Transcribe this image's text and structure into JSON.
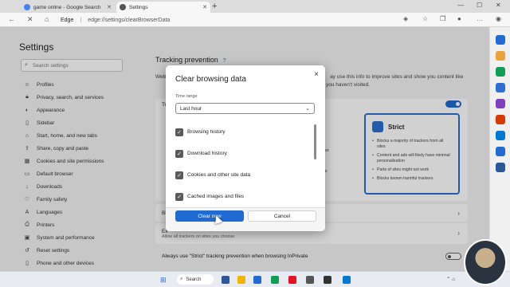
{
  "tabs": [
    {
      "title": "game online - Google Search",
      "favicon_color": "#4285f4"
    },
    {
      "title": "Settings",
      "favicon_color": "#555555"
    }
  ],
  "tab_new": "+",
  "window": {
    "min": "—",
    "max": "☐",
    "close": "✕"
  },
  "address": {
    "brand": "Edge",
    "separator": "|",
    "url": "edge://settings/clearBrowserData"
  },
  "sidebar": {
    "title": "Settings",
    "search_placeholder": "Search settings",
    "items": [
      {
        "label": "Profiles",
        "icon": "person-icon"
      },
      {
        "label": "Privacy, search, and services",
        "icon": "lock-icon"
      },
      {
        "label": "Appearance",
        "icon": "palette-icon"
      },
      {
        "label": "Sidebar",
        "icon": "sidebar-icon"
      },
      {
        "label": "Start, home, and new tabs",
        "icon": "home-icon"
      },
      {
        "label": "Share, copy and paste",
        "icon": "share-icon"
      },
      {
        "label": "Cookies and site permissions",
        "icon": "cookie-icon"
      },
      {
        "label": "Default browser",
        "icon": "browser-icon"
      },
      {
        "label": "Downloads",
        "icon": "download-icon"
      },
      {
        "label": "Family safety",
        "icon": "family-icon"
      },
      {
        "label": "Languages",
        "icon": "language-icon"
      },
      {
        "label": "Printers",
        "icon": "printer-icon"
      },
      {
        "label": "System and performance",
        "icon": "system-icon"
      },
      {
        "label": "Reset settings",
        "icon": "reset-icon"
      },
      {
        "label": "Phone and other devices",
        "icon": "phone-icon"
      }
    ]
  },
  "content": {
    "section_title": "Tracking prevention",
    "help": "?",
    "description_prefix": "Web",
    "description": "ay use this info to improve sites and show you content like",
    "description_line2": "you haven't visited.",
    "panel_label_left": "Tr",
    "peek_lines": [
      "you",
      "y be less",
      "ted",
      "trackers"
    ],
    "strict": {
      "title": "Strict",
      "bullets": [
        "Blocks a majority of trackers from all sites",
        "Content and ads will likely have minimal personalization",
        "Parts of sites might not work",
        "Blocks known harmful trackers"
      ]
    },
    "row1_label": "Bl",
    "row2_label": "Ex",
    "row2_sub": "Allow all trackers on sites you choose",
    "inprivate": "Always use \"Strict\" tracking prevention when browsing InPrivate"
  },
  "dialog": {
    "title": "Clear browsing data",
    "close": "×",
    "time_range_label": "Time range",
    "time_range_value": "Last hour",
    "options": [
      {
        "label": "Browsing history",
        "checked": true
      },
      {
        "label": "Download history",
        "checked": true
      },
      {
        "label": "Cookies and other site data",
        "checked": true
      },
      {
        "label": "Cached images and files",
        "checked": true
      }
    ],
    "clear_label": "Clear now",
    "cancel_label": "Cancel"
  },
  "taskbar": {
    "search_label": "Search",
    "apps": [
      "#2b579a",
      "#f2b400",
      "#1f6bd1",
      "#0f9d58",
      "#e81123",
      "#555555",
      "#333333",
      "#0078d4"
    ]
  },
  "edge_sidebar_colors": [
    "#1f6bd1",
    "#e8a33b",
    "#0f9d58",
    "#2a6fd1",
    "#7f3fbf",
    "#2b579a",
    "#d83b01",
    "#0078d4",
    "#1f6bd1"
  ]
}
